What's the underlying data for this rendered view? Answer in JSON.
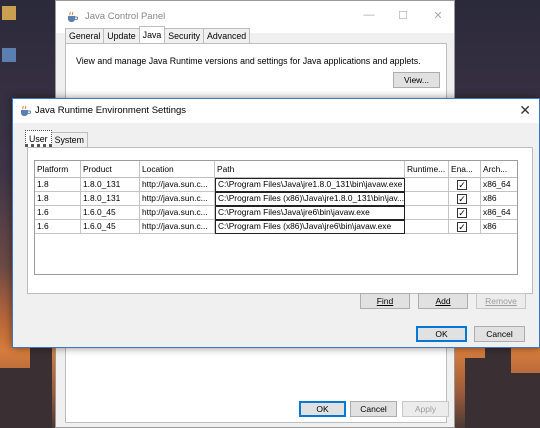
{
  "control_panel": {
    "title": "Java Control Panel",
    "tabs": [
      "General",
      "Update",
      "Java",
      "Security",
      "Advanced"
    ],
    "active_tab": "Java",
    "description": "View and manage Java Runtime versions and settings for Java applications and applets.",
    "view_button": "View...",
    "ok_button": "OK",
    "cancel_button": "Cancel",
    "apply_button": "Apply",
    "minimize_glyph": "—",
    "maximize_glyph": "☐",
    "close_glyph": "✕"
  },
  "jre_dialog": {
    "title": "Java Runtime Environment Settings",
    "close_glyph": "✕",
    "tabs": [
      "User",
      "System"
    ],
    "active_tab": "User",
    "table": {
      "headers": [
        "Platform",
        "Product",
        "Location",
        "Path",
        "Runtime...",
        "Ena...",
        "Arch..."
      ],
      "rows": [
        {
          "platform": "1.8",
          "product": "1.8.0_131",
          "location": "http://java.sun.c...",
          "path": "C:\\Program Files\\Java\\jre1.8.0_131\\bin\\javaw.exe",
          "runtime": "",
          "enabled": true,
          "arch": "x86_64"
        },
        {
          "platform": "1.8",
          "product": "1.8.0_131",
          "location": "http://java.sun.c...",
          "path": "C:\\Program Files (x86)\\Java\\jre1.8.0_131\\bin\\jav...",
          "runtime": "",
          "enabled": true,
          "arch": "x86"
        },
        {
          "platform": "1.6",
          "product": "1.6.0_45",
          "location": "http://java.sun.c...",
          "path": "C:\\Program Files\\Java\\jre6\\bin\\javaw.exe",
          "runtime": "",
          "enabled": true,
          "arch": "x86_64"
        },
        {
          "platform": "1.6",
          "product": "1.6.0_45",
          "location": "http://java.sun.c...",
          "path": "C:\\Program Files (x86)\\Java\\jre6\\bin\\javaw.exe",
          "runtime": "",
          "enabled": true,
          "arch": "x86"
        }
      ]
    },
    "buttons": {
      "find": "Find",
      "add": "Add",
      "remove": "Remove",
      "ok": "OK",
      "cancel": "Cancel"
    },
    "checkmark_glyph": "✓"
  },
  "colors": {
    "accent": "#0078d7",
    "dialog_border": "#3b78c4",
    "window_bg": "#f0f0f0"
  },
  "icons": [
    "java-cup-icon",
    "minimize-icon",
    "maximize-icon",
    "close-icon",
    "checkbox-checked-icon"
  ]
}
